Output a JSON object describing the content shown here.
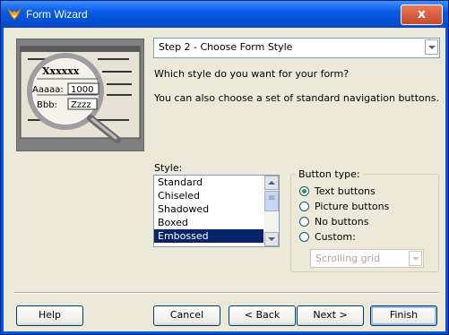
{
  "window": {
    "title": "Form Wizard",
    "close_label": "x"
  },
  "illustration": {
    "title_text": "Xxxxxx",
    "field1_label": "Aaaaa:",
    "field1_value": "1000",
    "field2_label": "Bbb:",
    "field2_value": "Zzzz"
  },
  "step": {
    "selected": "Step 2 - Choose Form Style"
  },
  "prompt": {
    "line1": "Which style do you want for your form?",
    "line2": "You can also choose a set of standard navigation buttons."
  },
  "style": {
    "label": "Style:",
    "items": [
      "Standard",
      "Chiseled",
      "Shadowed",
      "Boxed",
      "Embossed"
    ],
    "selected": "Embossed"
  },
  "button_type": {
    "label": "Button type:",
    "options": [
      {
        "label": "Text buttons",
        "checked": true
      },
      {
        "label": "Picture buttons",
        "checked": false
      },
      {
        "label": "No buttons",
        "checked": false
      },
      {
        "label": "Custom:",
        "checked": false
      }
    ],
    "custom_value": "Scrolling grid"
  },
  "footer": {
    "help": "Help",
    "cancel": "Cancel",
    "back": "< Back",
    "next": "Next >",
    "finish": "Finish"
  }
}
